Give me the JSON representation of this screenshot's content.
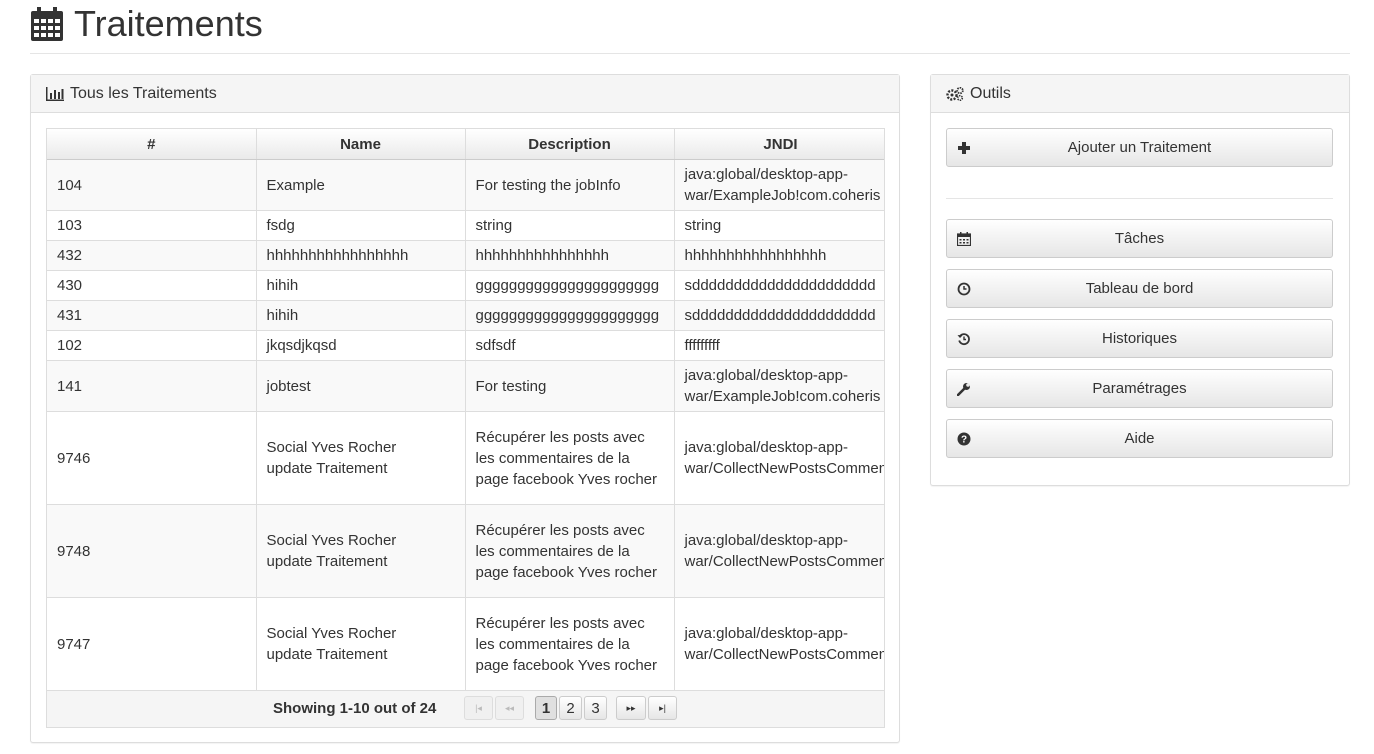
{
  "header": {
    "title": "Traitements",
    "icon": "calendar-icon"
  },
  "left_panel": {
    "title": "Tous les Traitements",
    "icon": "bar-chart-icon",
    "columns": [
      "#",
      "Name",
      "Description",
      "JNDI"
    ],
    "rows": [
      {
        "id": "104",
        "name": "Example",
        "description": "For testing the jobInfo",
        "jndi": "java:global/desktop-app-war/ExampleJob!com.coheris"
      },
      {
        "id": "103",
        "name": "fsdg",
        "description": "string",
        "jndi": "string"
      },
      {
        "id": "432",
        "name": "hhhhhhhhhhhhhhhhh",
        "description": "hhhhhhhhhhhhhhhh",
        "jndi": "hhhhhhhhhhhhhhhhh"
      },
      {
        "id": "430",
        "name": "hihih",
        "description": "gggggggggggggggggggggg",
        "jndi": "sdddddddddddddddddddddd"
      },
      {
        "id": "431",
        "name": "hihih",
        "description": "gggggggggggggggggggggg",
        "jndi": "sdddddddddddddddddddddd"
      },
      {
        "id": "102",
        "name": "jkqsdjkqsd",
        "description": "sdfsdf",
        "jndi": "fffffffff"
      },
      {
        "id": "141",
        "name": "jobtest",
        "description": "For testing",
        "jndi": "java:global/desktop-app-war/ExampleJob!com.coheris"
      },
      {
        "id": "9746",
        "name": "Social Yves Rocher update Traitement",
        "description": "Récupérer les posts avec les commentaires de la page facebook Yves rocher",
        "jndi": "java:global/desktop-app-war/CollectNewPostsCommen"
      },
      {
        "id": "9748",
        "name": "Social Yves Rocher update Traitement",
        "description": "Récupérer les posts avec les commentaires de la page facebook Yves rocher",
        "jndi": "java:global/desktop-app-war/CollectNewPostsCommen"
      },
      {
        "id": "9747",
        "name": "Social Yves Rocher update Traitement",
        "description": "Récupérer les posts avec les commentaires de la page facebook Yves rocher",
        "jndi": "java:global/desktop-app-war/CollectNewPostsCommen"
      }
    ],
    "pagination": {
      "info": "Showing 1-10 out of 24",
      "first": "|◂",
      "prev": "◂◂",
      "pages": [
        "1",
        "2",
        "3"
      ],
      "current": "1",
      "next": "▸▸",
      "last": "▸|"
    }
  },
  "right_panel": {
    "title": "Outils",
    "icon": "cogs-icon",
    "add_button": {
      "label": "Ajouter un Traitement",
      "icon": "plus-icon"
    },
    "buttons": [
      {
        "label": "Tâches",
        "icon": "calendar-icon"
      },
      {
        "label": "Tableau de bord",
        "icon": "clock-icon"
      },
      {
        "label": "Historiques",
        "icon": "history-icon"
      },
      {
        "label": "Paramétrages",
        "icon": "wrench-icon"
      },
      {
        "label": "Aide",
        "icon": "question-icon"
      }
    ]
  }
}
